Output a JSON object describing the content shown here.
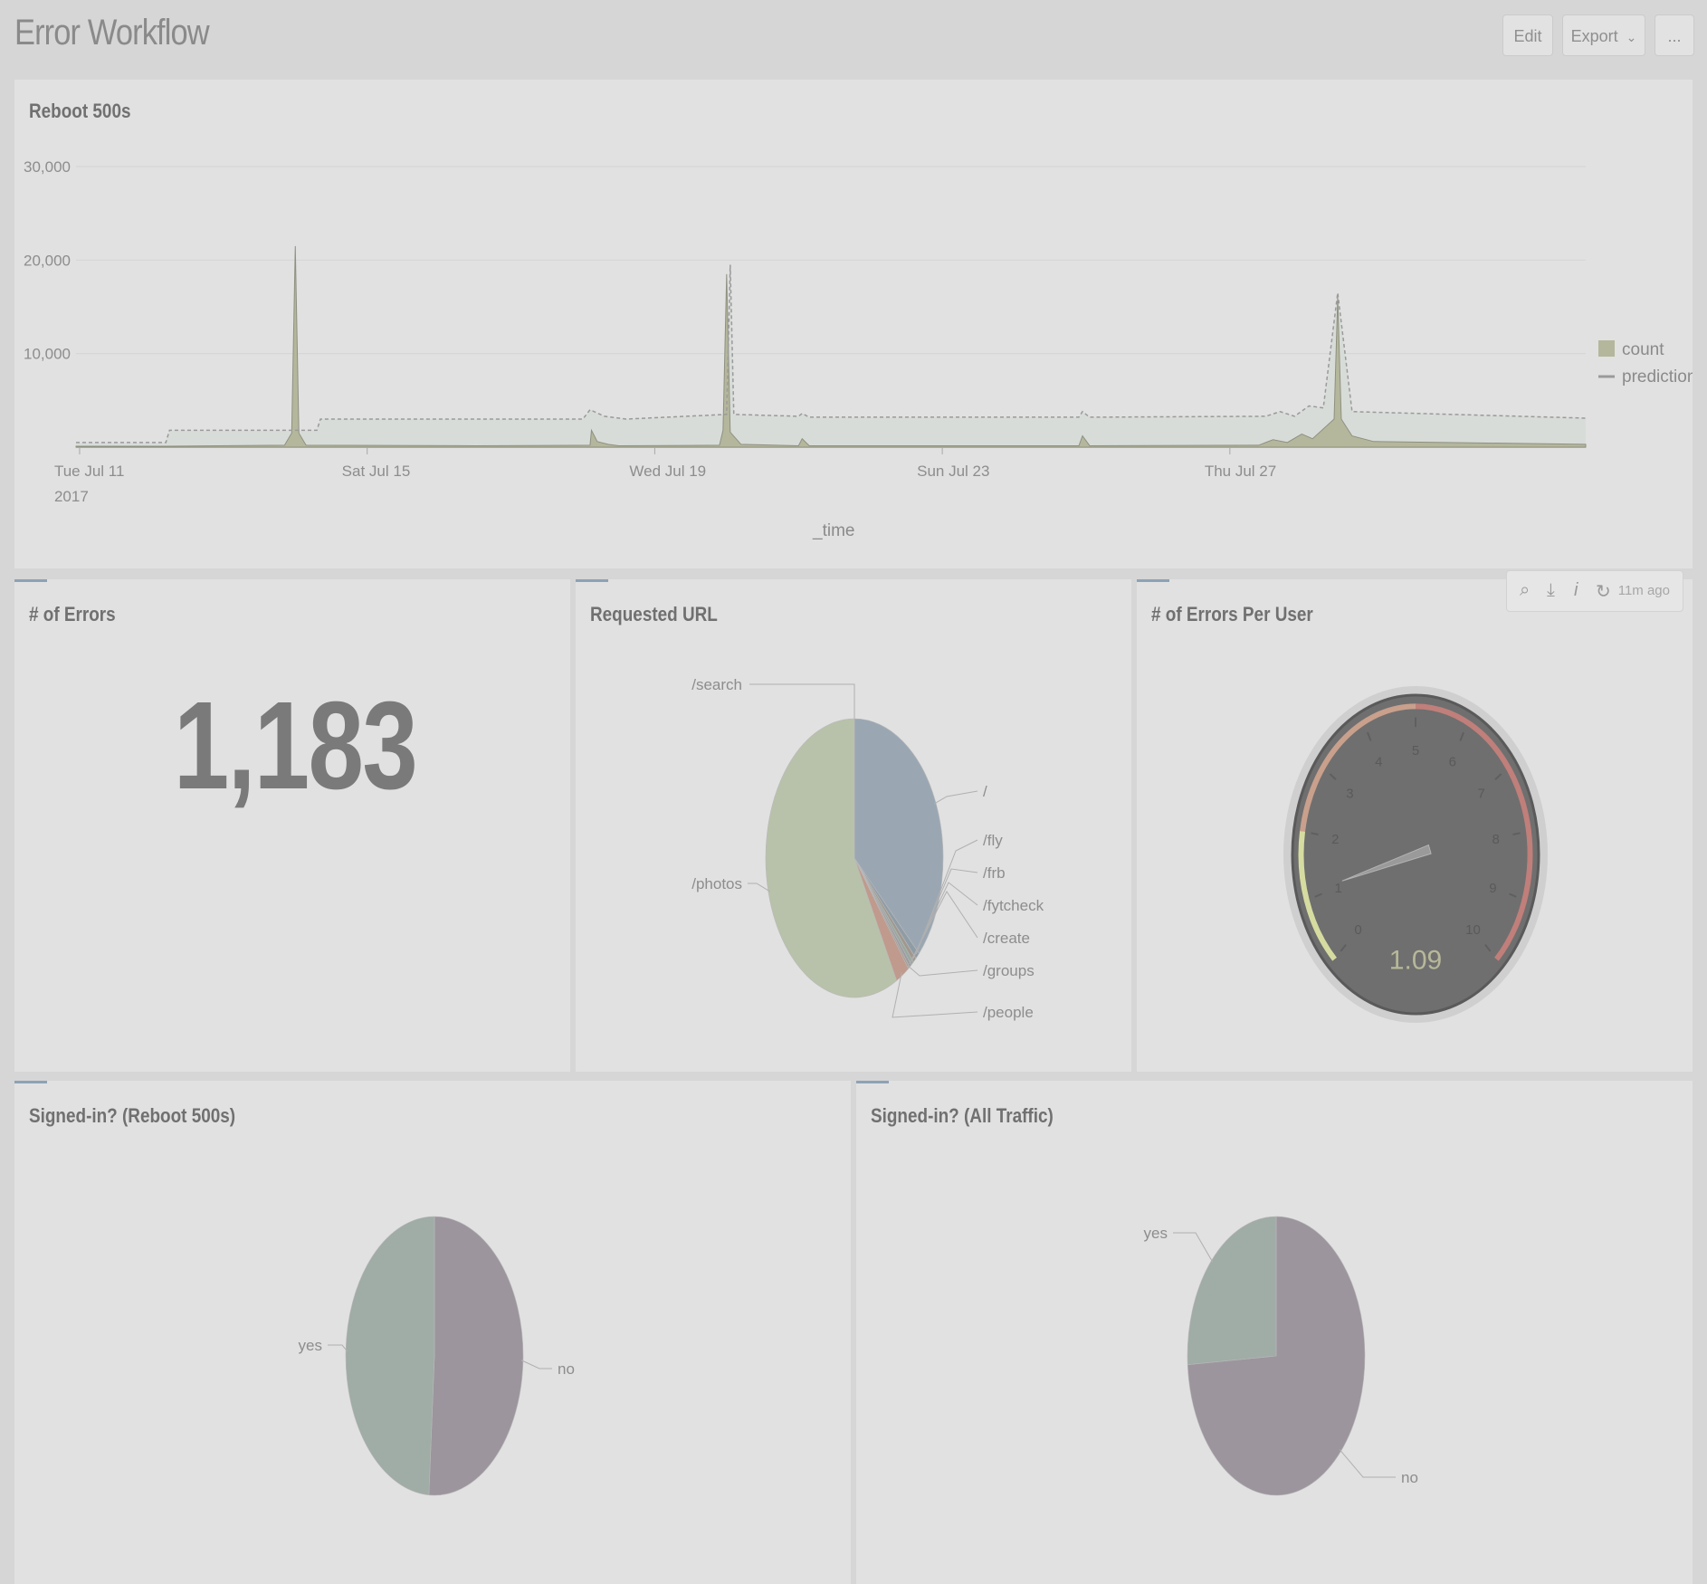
{
  "header": {
    "title": "Error Workflow",
    "edit_label": "Edit",
    "export_label": "Export",
    "export_caret": "⌄",
    "more_label": "..."
  },
  "timechart_panel": {
    "title": "Reboot 500s"
  },
  "errors_panel": {
    "title": "# of Errors",
    "value": "1,183"
  },
  "url_panel": {
    "title": "Requested URL"
  },
  "gauge_panel": {
    "title": "# of Errors Per User",
    "toolbar": {
      "search_icon": "search-icon",
      "download_icon": "download-icon",
      "info_icon": "info-icon",
      "refresh_icon": "refresh-icon",
      "ago": "11m ago"
    }
  },
  "signed_reboot_panel": {
    "title": "Signed-in? (Reboot 500s)"
  },
  "signed_all_panel": {
    "title": "Signed-in? (All Traffic)"
  },
  "chart_data": [
    {
      "type": "area",
      "title": "Reboot 500s",
      "xlabel": "_time",
      "ylabel": "",
      "ylim": [
        0,
        30000
      ],
      "yticks": [
        "10,000",
        "20,000",
        "30,000"
      ],
      "xticks": [
        {
          "label": "Tue Jul 11",
          "sublabel": "2017",
          "day": 11
        },
        {
          "label": "Sat Jul 15",
          "sublabel": "",
          "day": 15
        },
        {
          "label": "Wed Jul 19",
          "sublabel": "",
          "day": 19
        },
        {
          "label": "Sun Jul 23",
          "sublabel": "",
          "day": 23
        },
        {
          "label": "Thu Jul 27",
          "sublabel": "",
          "day": 27
        }
      ],
      "xrange_days": [
        10.95,
        31.95
      ],
      "series": [
        {
          "name": "count",
          "color": "#b5b79c",
          "points": [
            [
              10.95,
              100
            ],
            [
              12.2,
              100
            ],
            [
              13.85,
              200
            ],
            [
              13.95,
              1500
            ],
            [
              14.0,
              21500
            ],
            [
              14.05,
              1500
            ],
            [
              14.15,
              200
            ],
            [
              16.5,
              150
            ],
            [
              18.1,
              200
            ],
            [
              18.12,
              1800
            ],
            [
              18.2,
              600
            ],
            [
              18.35,
              300
            ],
            [
              18.5,
              150
            ],
            [
              19.9,
              200
            ],
            [
              19.95,
              1800
            ],
            [
              20.0,
              18500
            ],
            [
              20.05,
              1600
            ],
            [
              20.2,
              300
            ],
            [
              21.0,
              150
            ],
            [
              21.05,
              900
            ],
            [
              21.15,
              150
            ],
            [
              24.9,
              150
            ],
            [
              24.95,
              1200
            ],
            [
              25.05,
              150
            ],
            [
              27.4,
              200
            ],
            [
              27.6,
              800
            ],
            [
              27.8,
              500
            ],
            [
              28.0,
              1400
            ],
            [
              28.15,
              900
            ],
            [
              28.45,
              3000
            ],
            [
              28.5,
              16000
            ],
            [
              28.55,
              3000
            ],
            [
              28.7,
              1200
            ],
            [
              29.0,
              600
            ],
            [
              30.0,
              500
            ],
            [
              31.95,
              300
            ]
          ]
        },
        {
          "name": "prediction",
          "color": "#9a9a9a",
          "points": [
            [
              10.95,
              500
            ],
            [
              12.2,
              500
            ],
            [
              12.25,
              1800
            ],
            [
              14.3,
              1800
            ],
            [
              14.35,
              3000
            ],
            [
              18.0,
              3000
            ],
            [
              18.1,
              4000
            ],
            [
              18.3,
              3300
            ],
            [
              18.6,
              3000
            ],
            [
              20.0,
              3500
            ],
            [
              20.05,
              19500
            ],
            [
              20.1,
              3500
            ],
            [
              21.0,
              3300
            ],
            [
              21.05,
              3600
            ],
            [
              21.15,
              3200
            ],
            [
              24.9,
              3200
            ],
            [
              24.95,
              3800
            ],
            [
              25.05,
              3200
            ],
            [
              27.5,
              3300
            ],
            [
              27.7,
              3800
            ],
            [
              27.9,
              3300
            ],
            [
              28.1,
              4400
            ],
            [
              28.3,
              4200
            ],
            [
              28.5,
              16500
            ],
            [
              28.7,
              3800
            ],
            [
              31.95,
              3100
            ]
          ]
        }
      ],
      "legend": {
        "position": "right",
        "entries": [
          "count",
          "prediction"
        ]
      }
    },
    {
      "type": "pie",
      "title": "Requested URL",
      "labels": [
        "/",
        "/fly",
        "/frb",
        "/fytcheck",
        "/create",
        "/groups",
        "/people",
        "/photos",
        "/search"
      ],
      "values": [
        37.0,
        0.8,
        0.6,
        0.5,
        0.4,
        0.3,
        2.5,
        57.9,
        0.0
      ],
      "colors": [
        "#9aa7b3",
        "#8f9ca6",
        "#a0988f",
        "#98a8a0",
        "#9e9aa2",
        "#a7a095",
        "#c09a8d",
        "#b8c2aa",
        "#b8c2aa"
      ]
    },
    {
      "type": "gauge",
      "title": "# of Errors Per User",
      "value": 1.09,
      "value_label": "1.09",
      "range": [
        0,
        10
      ],
      "tick_labels": [
        "0",
        "1",
        "2",
        "3",
        "4",
        "5",
        "6",
        "7",
        "8",
        "9",
        "10"
      ],
      "bands": [
        {
          "from": 0,
          "to": 2,
          "color": "#d6dca0"
        },
        {
          "from": 2,
          "to": 5,
          "color": "#c9a08c"
        },
        {
          "from": 5,
          "to": 10,
          "color": "#c07f7a"
        }
      ]
    },
    {
      "type": "pie",
      "title": "Signed-in? (Reboot 500s)",
      "labels": [
        "no",
        "yes"
      ],
      "values": [
        51,
        49
      ],
      "colors": [
        "#9c959d",
        "#a0aca6"
      ]
    },
    {
      "type": "pie",
      "title": "Signed-in? (All Traffic)",
      "labels": [
        "no",
        "yes"
      ],
      "values": [
        74,
        26
      ],
      "colors": [
        "#9c959d",
        "#a0aca6"
      ]
    }
  ]
}
